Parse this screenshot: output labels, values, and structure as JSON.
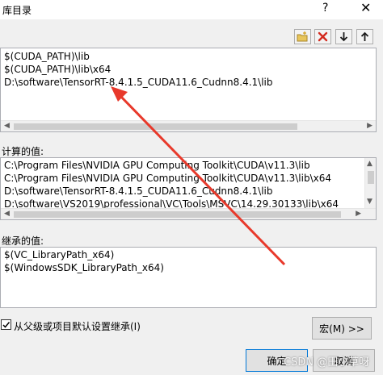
{
  "window": {
    "title": "库目录",
    "help_glyph": "?",
    "close_glyph": "✕"
  },
  "toolbar": {
    "new_line_icon": "folder-new-icon",
    "delete_icon": "delete-x-icon",
    "move_down_icon": "arrow-down-icon",
    "move_up_icon": "arrow-up-icon"
  },
  "edit_list": {
    "lines": [
      "$(CUDA_PATH)\\lib",
      "$(CUDA_PATH)\\lib\\x64",
      "D:\\software\\TensorRT-8.4.1.5_CUDA11.6_Cudnn8.4.1\\lib"
    ]
  },
  "evaluated": {
    "label": "计算的值:",
    "lines": [
      "C:\\Program Files\\NVIDIA GPU Computing Toolkit\\CUDA\\v11.3\\lib",
      "C:\\Program Files\\NVIDIA GPU Computing Toolkit\\CUDA\\v11.3\\lib\\x64",
      "D:\\software\\TensorRT-8.4.1.5_CUDA11.6_Cudnn8.4.1\\lib",
      "D:\\software\\VS2019\\professional\\VC\\Tools\\MSVC\\14.29.30133\\lib\\x64"
    ]
  },
  "inherited": {
    "label": "继承的值:",
    "lines": [
      "$(VC_LibraryPath_x64)",
      "$(WindowsSDK_LibraryPath_x64)"
    ]
  },
  "inherit_checkbox": {
    "label": "从父级或项目默认设置继承(I)",
    "checked": true
  },
  "buttons": {
    "macro": "宏(M) >>",
    "ok": "确定",
    "cancel": "取消"
  },
  "watermark": "CSDN @田小草呀",
  "colors": {
    "annotation_arrow": "#e8392b",
    "delete_red": "#d32a1e"
  }
}
